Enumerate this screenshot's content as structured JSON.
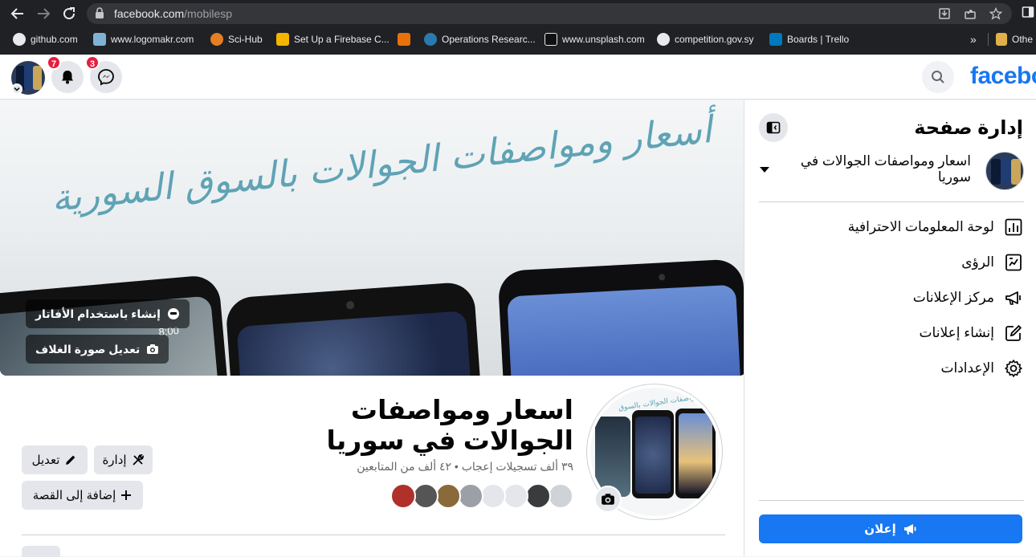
{
  "browser": {
    "url_domain": "facebook.com",
    "url_path": "/mobilesp",
    "bookmarks": [
      {
        "label": "github.com",
        "color": "#24292e"
      },
      {
        "label": "www.logomakr.com",
        "color": "#7fb3d5"
      },
      {
        "label": "Sci-Hub",
        "color": "#e67e22"
      },
      {
        "label": "Set Up a Firebase C...",
        "color": "#f5b400"
      },
      {
        "label": "",
        "color": "#e8710a"
      },
      {
        "label": "Operations Researc...",
        "color": "#2a7ab0"
      },
      {
        "label": "www.unsplash.com",
        "color": "#111111"
      },
      {
        "label": "competition.gov.sy",
        "color": "#e8eaed"
      },
      {
        "label": "Boards | Trello",
        "color": "#0079bf"
      }
    ],
    "more_bookmarks": "»",
    "other_folder": "Othe"
  },
  "fbnav": {
    "logo": "facebo",
    "notifications_count": "7",
    "messenger_count": "3"
  },
  "cover": {
    "headline": "أسعار ومواصفات الجوالات بالسوق السورية",
    "phone_clock": "8:00",
    "avatar_button": "إنشاء باستخدام الأفاتار",
    "edit_cover_button": "تعديل صورة الغلاف"
  },
  "page": {
    "name": "اسعار ومواصفات الجوالات في سوريا",
    "stats": "٣٩ ألف تسجيلات إعجاب • ٤٢ ألف من المتابعين",
    "manage_button": "إدارة",
    "edit_button": "تعديل",
    "add_story_button": "إضافة إلى القصة",
    "profile_banner": "مواصفات الجوالات بالسوق"
  },
  "side": {
    "title": "إدارة صفحة",
    "page_name": "اسعار ومواصفات الجوالات في سوريا",
    "menu": [
      {
        "label": "لوحة المعلومات الاحترافية",
        "icon": "chart-icon"
      },
      {
        "label": "الرؤى",
        "icon": "insights-icon"
      },
      {
        "label": "مركز الإعلانات",
        "icon": "megaphone-icon"
      },
      {
        "label": "إنشاء إعلانات",
        "icon": "pencil-icon"
      },
      {
        "label": "الإعدادات",
        "icon": "gear-icon"
      }
    ],
    "promote_button": "إعلان",
    "accent": "#1877f2"
  }
}
